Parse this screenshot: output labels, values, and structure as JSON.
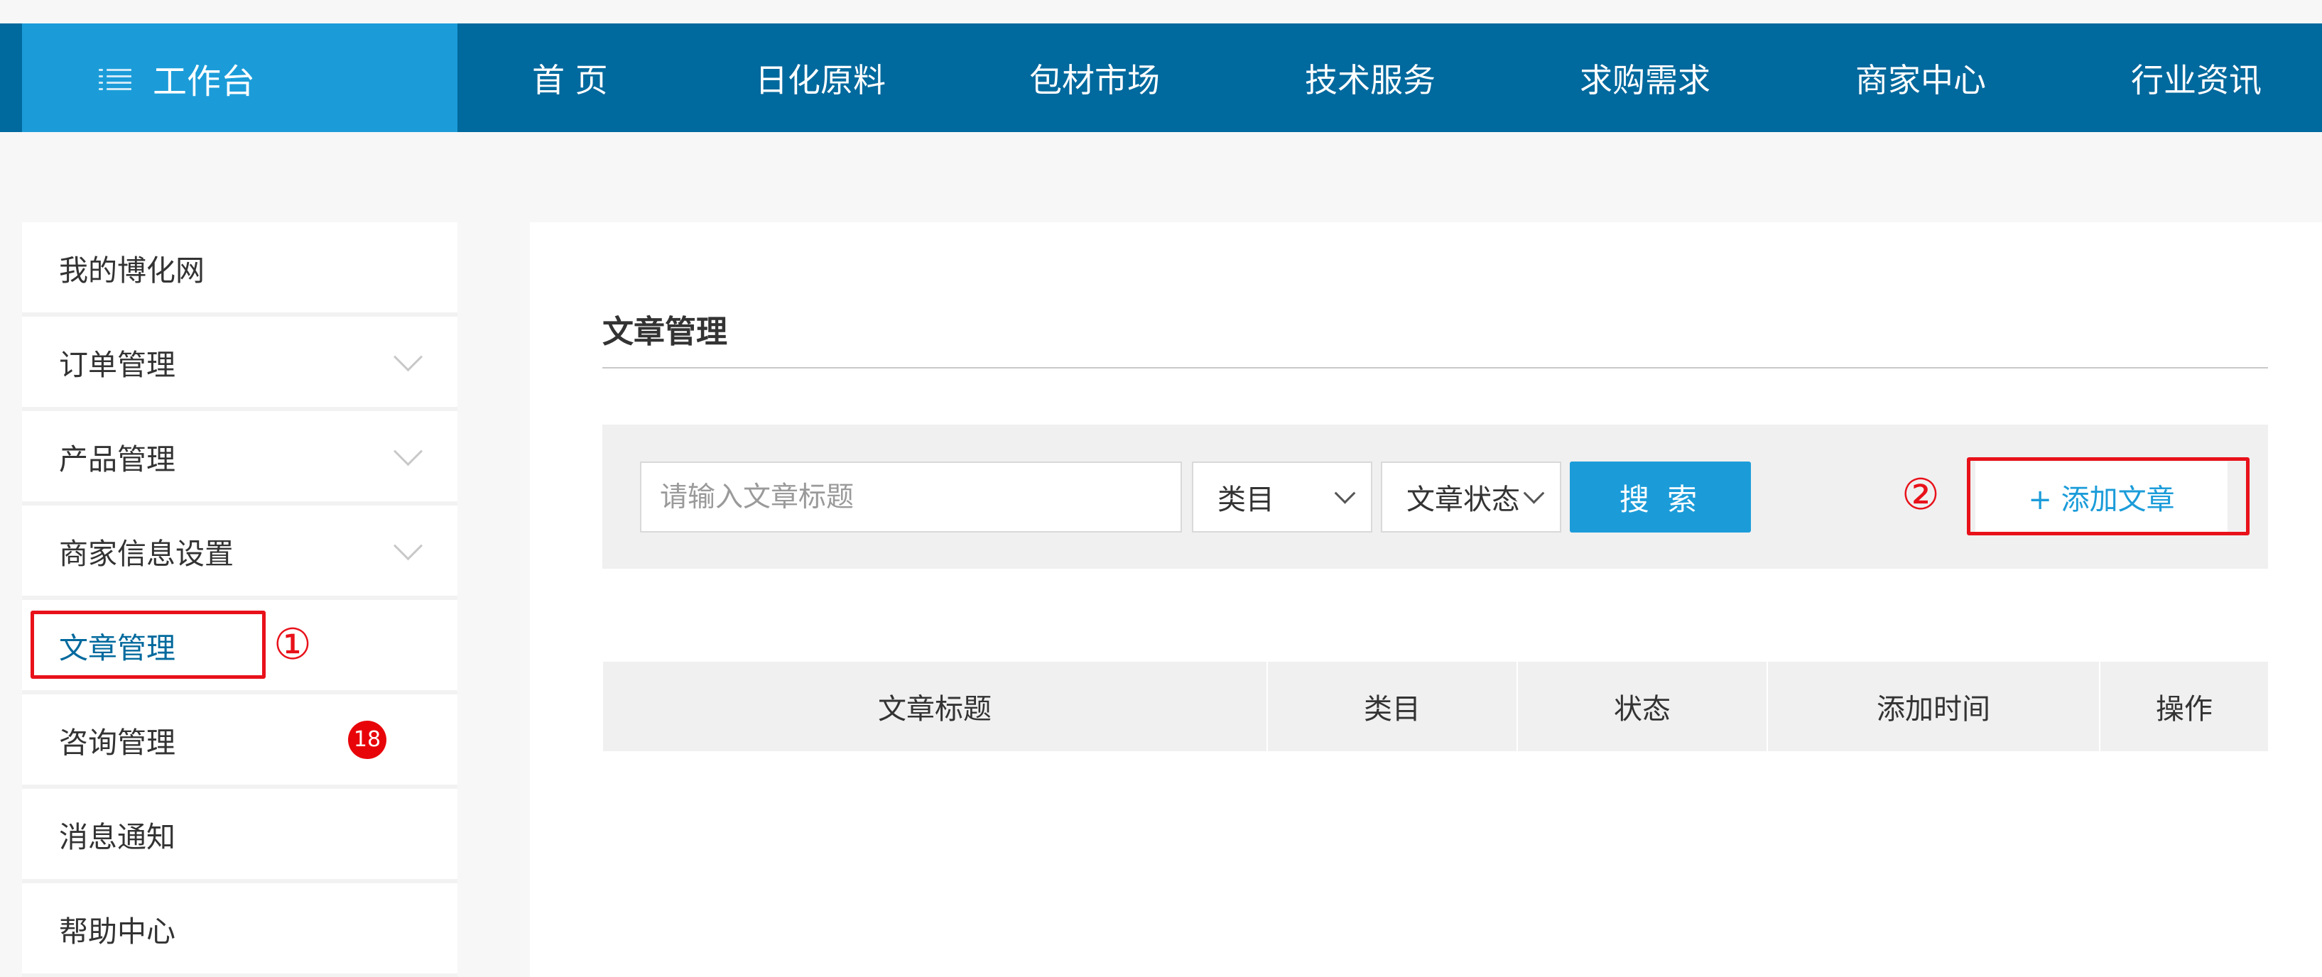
{
  "header": {
    "workbench_label": "工作台",
    "workbench_icon": "list-icon",
    "nav_items": [
      "首 页",
      "日化原料",
      "包材市场",
      "技术服务",
      "求购需求",
      "商家中心",
      "行业资讯"
    ]
  },
  "sidebar": {
    "items": [
      {
        "label": "我的博化网"
      },
      {
        "label": "订单管理",
        "icon": "chevron-down-icon"
      },
      {
        "label": "产品管理",
        "icon": "chevron-down-icon"
      },
      {
        "label": "商家信息设置",
        "icon": "chevron-down-icon"
      },
      {
        "label": "文章管理",
        "active": true
      },
      {
        "label": "咨询管理",
        "badge": "18"
      },
      {
        "label": "消息通知"
      },
      {
        "label": "帮助中心"
      }
    ]
  },
  "annotations": {
    "marker_1": "①",
    "marker_2": "②"
  },
  "main": {
    "title": "文章管理",
    "search": {
      "placeholder": "请输入文章标题",
      "category_select": "类目",
      "status_select": "文章状态",
      "search_button": "搜 索",
      "add_button": "+ 添加文章"
    },
    "table": {
      "columns": [
        "文章标题",
        "类目",
        "状态",
        "添加时间",
        "操作"
      ]
    }
  },
  "colors": {
    "nav_bar": "#00699d",
    "workbench": "#1b9cd9",
    "accent": "#1b9cd9",
    "annotation_red": "#e8111a",
    "badge_red": "#e8050a"
  }
}
